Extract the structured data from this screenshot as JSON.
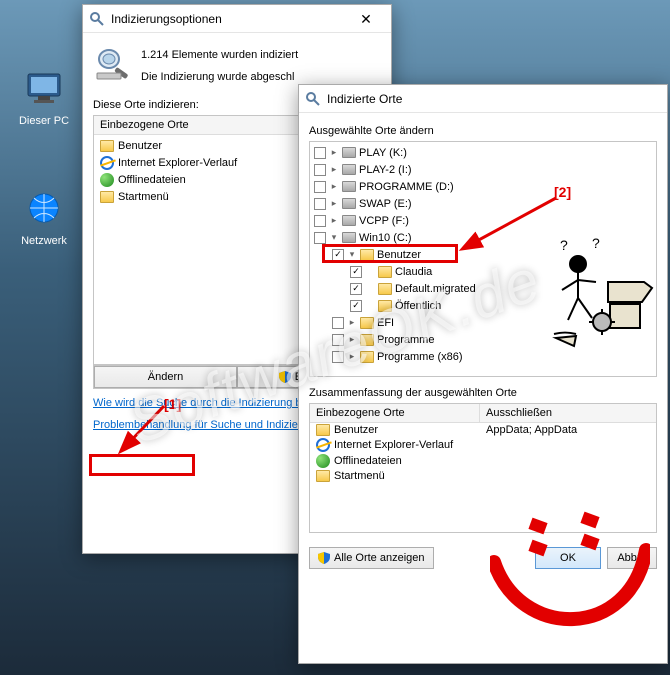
{
  "desktop": {
    "this_pc": "Dieser PC",
    "network": "Netzwerk"
  },
  "watermark": "SoftwareOK.de",
  "annot": {
    "tag1": "[1]",
    "tag2": "[2]"
  },
  "win1": {
    "title": "Indizierungsoptionen",
    "status1": "1.214 Elemente wurden indiziert",
    "status2": "Die Indizierung wurde abgeschl",
    "label_locations": "Diese Orte indizieren:",
    "col_included": "Einbezogene Orte",
    "items": [
      {
        "icon": "folder",
        "label": "Benutzer"
      },
      {
        "icon": "ie",
        "label": "Internet Explorer-Verlauf"
      },
      {
        "icon": "offline",
        "label": "Offlinedateien"
      },
      {
        "icon": "folder",
        "label": "Startmenü"
      }
    ],
    "btn_modify": "Ändern",
    "btn_advanced": "Erweitert",
    "link1": "Wie wird die Suche durch die Indizierung beeinflu",
    "link2": "Problembehandlung für Suche und Indizierung"
  },
  "win2": {
    "title": "Indizierte Orte",
    "label_change": "Ausgewählte Orte ändern",
    "tree": [
      {
        "depth": 0,
        "checked": false,
        "chev": ">",
        "icon": "drive",
        "label": "PLAY (K:)"
      },
      {
        "depth": 0,
        "checked": false,
        "chev": ">",
        "icon": "drive",
        "label": "PLAY-2 (I:)"
      },
      {
        "depth": 0,
        "checked": false,
        "chev": ">",
        "icon": "drive",
        "label": "PROGRAMME (D:)"
      },
      {
        "depth": 0,
        "checked": false,
        "chev": ">",
        "icon": "drive",
        "label": "SWAP (E:)"
      },
      {
        "depth": 0,
        "checked": false,
        "chev": ">",
        "icon": "drive",
        "label": "VCPP (F:)"
      },
      {
        "depth": 0,
        "checked": false,
        "chev": "v",
        "icon": "drive",
        "label": "Win10 (C:)"
      },
      {
        "depth": 1,
        "checked": true,
        "chev": "v",
        "icon": "folder",
        "label": "Benutzer"
      },
      {
        "depth": 2,
        "checked": true,
        "chev": "",
        "icon": "folder",
        "label": "Claudia"
      },
      {
        "depth": 2,
        "checked": true,
        "chev": "",
        "icon": "folder",
        "label": "Default.migrated"
      },
      {
        "depth": 2,
        "checked": true,
        "chev": "",
        "icon": "folder",
        "label": "Öffentlich"
      },
      {
        "depth": 1,
        "checked": false,
        "chev": ">",
        "icon": "folder",
        "label": "EFI"
      },
      {
        "depth": 1,
        "checked": false,
        "chev": ">",
        "icon": "folder",
        "label": "Programme"
      },
      {
        "depth": 1,
        "checked": false,
        "chev": ">",
        "icon": "folder",
        "label": "Programme (x86)"
      }
    ],
    "label_summary": "Zusammenfassung der ausgewählten Orte",
    "col_included": "Einbezogene Orte",
    "col_exclude": "Ausschließen",
    "summary": [
      {
        "icon": "folder",
        "label": "Benutzer",
        "exclude": "AppData; AppData"
      },
      {
        "icon": "ie",
        "label": "Internet Explorer-Verlauf",
        "exclude": ""
      },
      {
        "icon": "offline",
        "label": "Offlinedateien",
        "exclude": ""
      },
      {
        "icon": "folder",
        "label": "Startmenü",
        "exclude": ""
      }
    ],
    "btn_showall": "Alle Orte anzeigen",
    "btn_ok": "OK",
    "btn_cancel": "Abbre"
  }
}
